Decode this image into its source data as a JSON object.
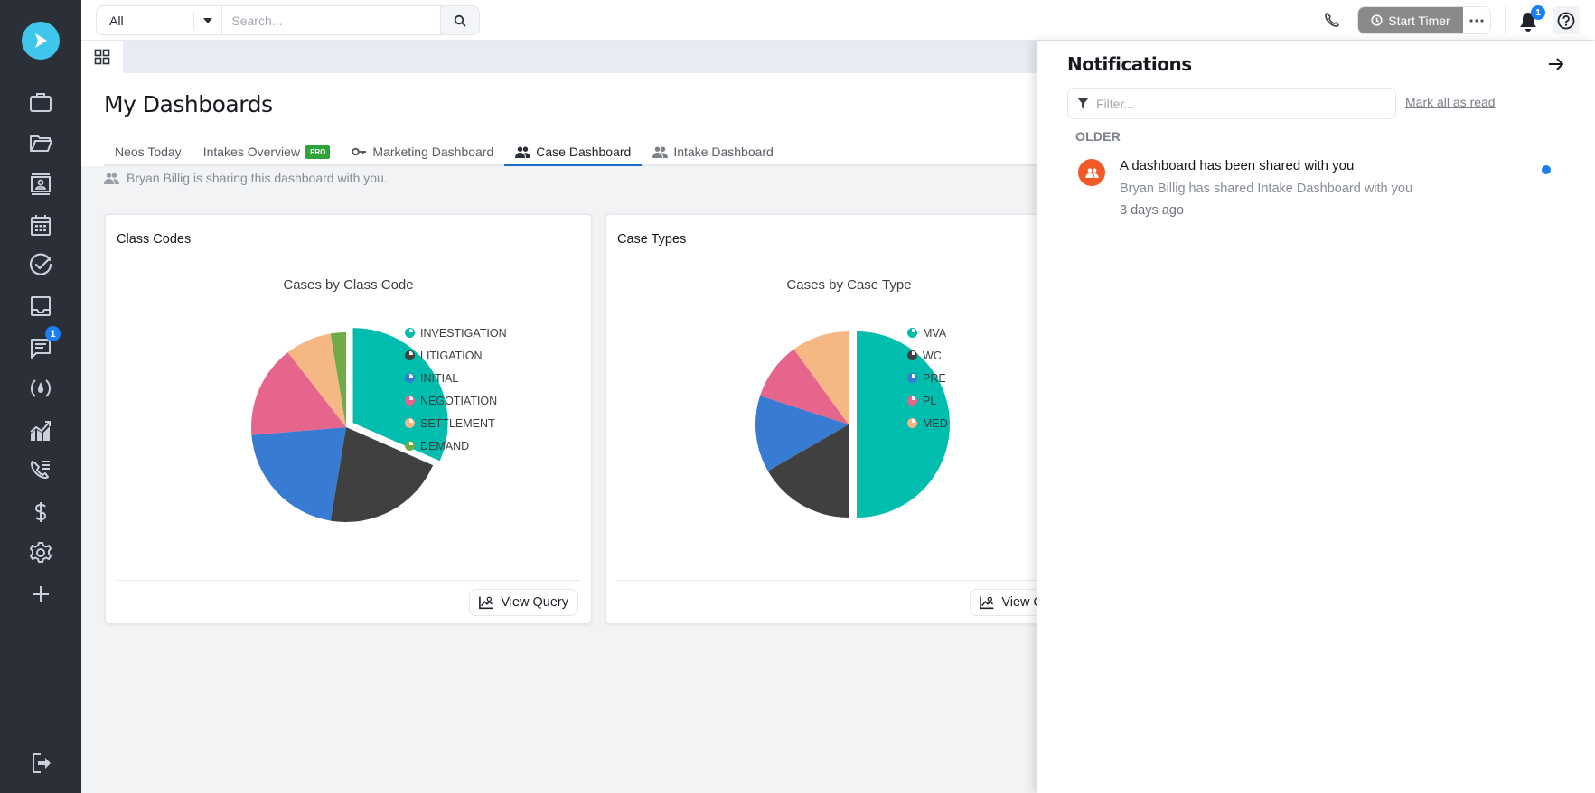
{
  "header": {
    "scope_select": "All",
    "search_placeholder": "Search...",
    "start_timer_label": "Start Timer",
    "notification_count": "1"
  },
  "sidebar": {
    "items": [
      {
        "name": "cases",
        "icon": "briefcase-icon"
      },
      {
        "name": "documents",
        "icon": "folder-icon"
      },
      {
        "name": "contacts",
        "icon": "contact-card-icon"
      },
      {
        "name": "calendar",
        "icon": "calendar-icon"
      },
      {
        "name": "tasks",
        "icon": "check-circle-icon"
      },
      {
        "name": "inbox",
        "icon": "inbox-icon"
      },
      {
        "name": "messages",
        "icon": "chat-icon",
        "badge": "1"
      },
      {
        "name": "intake",
        "icon": "drop-icon"
      },
      {
        "name": "reports",
        "icon": "chart-icon"
      },
      {
        "name": "call-log",
        "icon": "phone-list-icon"
      },
      {
        "name": "billing",
        "icon": "dollar-icon"
      },
      {
        "name": "settings",
        "icon": "gear-icon"
      },
      {
        "name": "add",
        "icon": "plus-icon"
      }
    ],
    "logout_icon": "logout-icon"
  },
  "page": {
    "title": "My Dashboards",
    "tabs": [
      {
        "label": "Neos Today",
        "icon": null,
        "active": false
      },
      {
        "label": "Intakes Overview",
        "badge": "PRO",
        "active": false
      },
      {
        "label": "Marketing Dashboard",
        "icon": "key-icon",
        "active": false
      },
      {
        "label": "Case Dashboard",
        "icon": "users-icon",
        "active": true
      },
      {
        "label": "Intake Dashboard",
        "icon": "users-icon",
        "active": false
      }
    ],
    "share_note": "Bryan Billig is sharing this dashboard with you."
  },
  "cards": [
    {
      "title": "Class Codes",
      "view_query_label": "View Query"
    },
    {
      "title": "Case Types",
      "view_query_label": "View Query"
    }
  ],
  "colors": {
    "teal": "#00bdad",
    "dark": "#404040",
    "blue": "#377bd3",
    "pink": "#e5658d",
    "peach": "#f5b885",
    "green": "#6fab46",
    "accent": "#1a6fc4",
    "badge_blue": "#1a7ff0",
    "notif_orange": "#f05a28"
  },
  "chart_data": [
    {
      "type": "pie",
      "title": "Cases by Class Code",
      "categories": [
        "INVESTIGATION",
        "LITIGATION",
        "INITIAL",
        "NEGOTIATION",
        "SETTLEMENT",
        "DEMAND"
      ],
      "values": [
        12,
        8,
        8,
        6,
        3,
        1
      ],
      "colors": [
        "#00bdad",
        "#404040",
        "#377bd3",
        "#e5658d",
        "#f5b885",
        "#6fab46"
      ],
      "exploded": "INVESTIGATION",
      "legend": "right"
    },
    {
      "type": "pie",
      "title": "Cases by Case Type",
      "categories": [
        "MVA",
        "WC",
        "PRE",
        "PL",
        "MED"
      ],
      "values": [
        15,
        5,
        4,
        3,
        3
      ],
      "colors": [
        "#00bdad",
        "#404040",
        "#377bd3",
        "#e5658d",
        "#f5b885"
      ],
      "exploded": "MVA",
      "legend": "right"
    }
  ],
  "notifications": {
    "title": "Notifications",
    "filter_placeholder": "Filter...",
    "mark_all_read": "Mark all as read",
    "groups": [
      {
        "label": "OLDER",
        "items": [
          {
            "title": "A dashboard has been shared with you",
            "body": "Bryan Billig has shared Intake Dashboard with you",
            "time": "3 days ago",
            "unread": true,
            "icon": "users-icon"
          }
        ]
      }
    ]
  }
}
